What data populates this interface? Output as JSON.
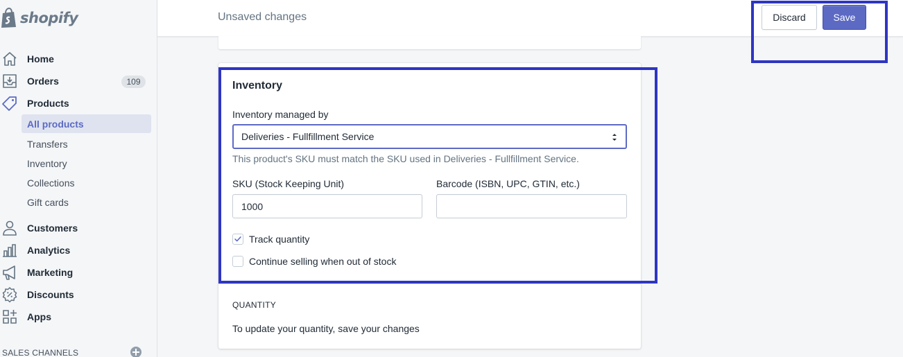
{
  "brand": {
    "logo_text": "shopify",
    "accent_color": "#5c6ac4",
    "highlight_color": "#2e35c2"
  },
  "sidebar": {
    "items": [
      {
        "label": "Home",
        "icon": "home-icon"
      },
      {
        "label": "Orders",
        "icon": "orders-icon",
        "badge": "109"
      },
      {
        "label": "Products",
        "icon": "tag-icon"
      },
      {
        "label": "Customers",
        "icon": "person-icon"
      },
      {
        "label": "Analytics",
        "icon": "bar-chart-icon"
      },
      {
        "label": "Marketing",
        "icon": "megaphone-icon"
      },
      {
        "label": "Discounts",
        "icon": "discount-icon"
      },
      {
        "label": "Apps",
        "icon": "apps-icon"
      }
    ],
    "product_subitems": [
      {
        "label": "All products",
        "active": true
      },
      {
        "label": "Transfers"
      },
      {
        "label": "Inventory"
      },
      {
        "label": "Collections"
      },
      {
        "label": "Gift cards"
      }
    ],
    "sales_channels_label": "SALES CHANNELS"
  },
  "topbar": {
    "title": "Unsaved changes",
    "discard_label": "Discard",
    "save_label": "Save"
  },
  "inventory": {
    "title": "Inventory",
    "managed_by_label": "Inventory managed by",
    "managed_by_value": "Deliveries - Fullfillment Service",
    "help_text": "This product's SKU must match the SKU used in Deliveries - Fullfillment Service.",
    "sku_label": "SKU (Stock Keeping Unit)",
    "sku_value": "1000",
    "barcode_label": "Barcode (ISBN, UPC, GTIN, etc.)",
    "barcode_value": "",
    "track_quantity_label": "Track quantity",
    "track_quantity_checked": true,
    "continue_selling_label": "Continue selling when out of stock",
    "continue_selling_checked": false
  },
  "quantity": {
    "heading": "QUANTITY",
    "text": "To update your quantity, save your changes"
  }
}
